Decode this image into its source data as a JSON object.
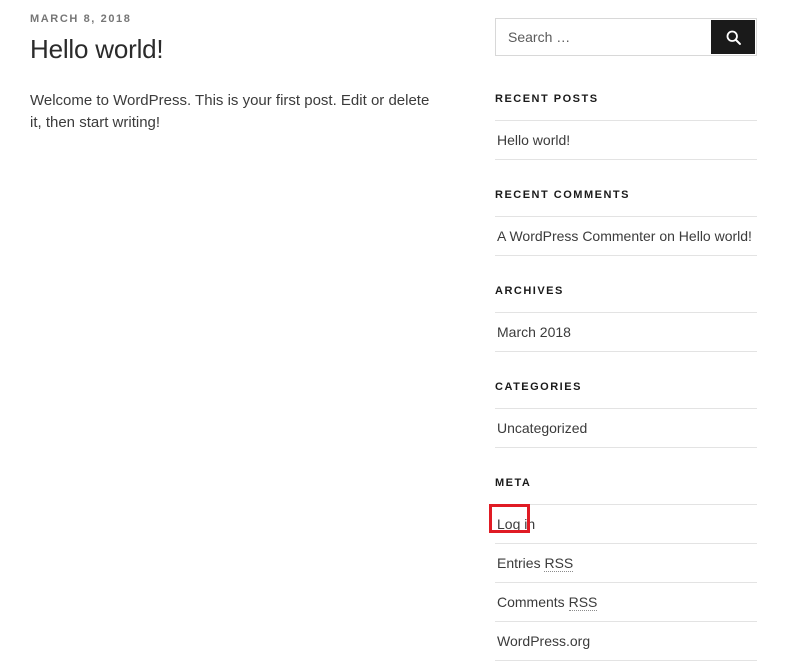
{
  "post": {
    "date": "MARCH 8, 2018",
    "title": "Hello world!",
    "excerpt": "Welcome to WordPress. This is your first post. Edit or delete it, then start writing!"
  },
  "sidebar": {
    "search": {
      "placeholder": "Search …",
      "value": "",
      "submit_icon": "search-icon"
    },
    "widgets": [
      {
        "id": "recent-posts",
        "title": "RECENT POSTS",
        "items": [
          {
            "label": "Hello world!"
          }
        ]
      },
      {
        "id": "recent-comments",
        "title": "RECENT COMMENTS",
        "items": [
          {
            "label": "A WordPress Commenter on Hello world!"
          }
        ]
      },
      {
        "id": "archives",
        "title": "ARCHIVES",
        "items": [
          {
            "label": "March 2018"
          }
        ]
      },
      {
        "id": "categories",
        "title": "CATEGORIES",
        "items": [
          {
            "label": "Uncategorized"
          }
        ]
      },
      {
        "id": "meta",
        "title": "META",
        "items": [
          {
            "label": "Log in"
          },
          {
            "label_prefix": "Entries ",
            "abbr": "RSS"
          },
          {
            "label_prefix": "Comments ",
            "abbr": "RSS"
          },
          {
            "label": "WordPress.org"
          }
        ]
      }
    ]
  },
  "annotation": {
    "target": "Log in",
    "color": "#e01b24"
  }
}
